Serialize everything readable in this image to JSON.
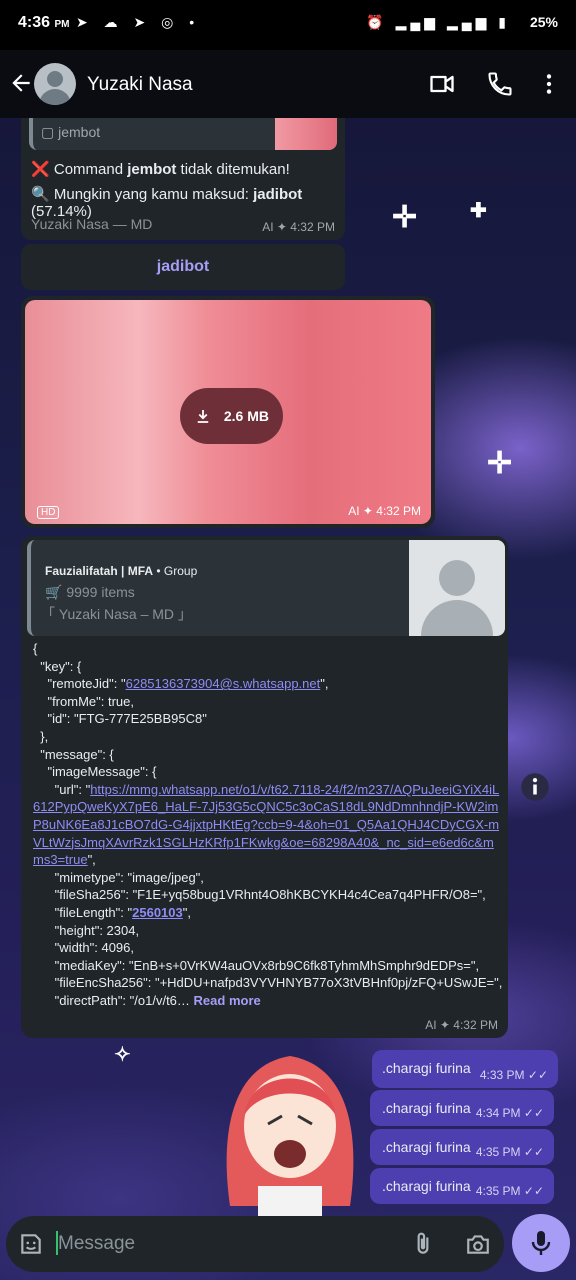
{
  "status_bar": {
    "time": "4:36",
    "time_suffix": "PM",
    "battery": "25%"
  },
  "header": {
    "contact_name": "Yuzaki Nasa"
  },
  "messages": {
    "m1": {
      "quote_label": "jembot",
      "line1_prefix": "Command ",
      "line1_bold": "jembot",
      "line1_suffix": " tidak ditemukan!",
      "line2_prefix": "Mungkin yang kamu maksud: ",
      "line2_bold": "jadibot",
      "line2_suffix": " (57.14%)",
      "footer": "Yuzaki Nasa — MD",
      "ai_label": "AI",
      "time": "4:32 PM"
    },
    "m2_button": "jadibot",
    "m3": {
      "download_size": "2.6 MB",
      "badge": "HD",
      "ai_label": "AI",
      "time": "4:32 PM"
    },
    "m4": {
      "group_name": "Fauzialifatah | MFA",
      "group_type": "• Group",
      "items": "9999 items",
      "footer": "「 Yuzaki Nasa – MD 」",
      "json_lines": [
        "{",
        "  \"key\": {",
        "    \"remoteJid\": \"",
        "6285136373904@s.whatsapp.net",
        "\",",
        "    \"fromMe\": true,",
        "    \"id\": \"FTG-777E25BB95C8\"",
        "  },",
        "  \"message\": {",
        "    \"imageMessage\": {",
        "      \"url\": \"",
        "https://mmg.whatsapp.net/o1/v/t62.7118-24/f2/m237/AQPuJeeiGYiX4iL612PypQweKyX7pE6_HaLF-7Jj53G5cQNC5c3oCaS18dL9NdDmnhndjP-KW2imP8uNK6Ea8J1cBO7dG-G4jjxtpHKtEg?ccb=9-4&oh=01_Q5Aa1QHJ4CDyCGX-mVLtWzjsJmqXAvrRzk1SGLHzKRfp1FKwkg&oe=68298A40&_nc_sid=e6ed6c&mms3=true",
        "\",",
        "      \"mimetype\": \"image/jpeg\",",
        "      \"fileSha256\": \"F1E+yq58bug1VRhnt4O8hKBCYKH4c4Cea7q4PHFR/O8=\",",
        "      \"fileLength\": \"",
        "2560103",
        "\",",
        "      \"height\": 2304,",
        "      \"width\": 4096,",
        "      \"mediaKey\": \"EnB+s+0VrKW4auOVx8rb9C6fk8TyhmMhSmphr9dEDPs=\",",
        "      \"fileEncSha256\": \"+HdDU+nafpd3VYVHNYB77oX3tVBHnf0pj/zFQ+USwJE=\",",
        "      \"directPath\": \"/o1/v/t6…"
      ],
      "read_more": "Read more",
      "ai_label": "AI",
      "time": "4:32 PM"
    },
    "outgoing": [
      {
        "text": ".charagi furina",
        "time": "4:33 PM"
      },
      {
        "text": ".charagi furina",
        "time": "4:34 PM"
      },
      {
        "text": ".charagi furina",
        "time": "4:35 PM"
      },
      {
        "text": ".charagi furina",
        "time": "4:35 PM"
      }
    ]
  },
  "composer": {
    "placeholder": "Message"
  },
  "colors": {
    "accent": "#a79df7",
    "bubble_in": "#1f2529",
    "bubble_out": "#4e3fb0",
    "link": "#8f8cf5"
  }
}
